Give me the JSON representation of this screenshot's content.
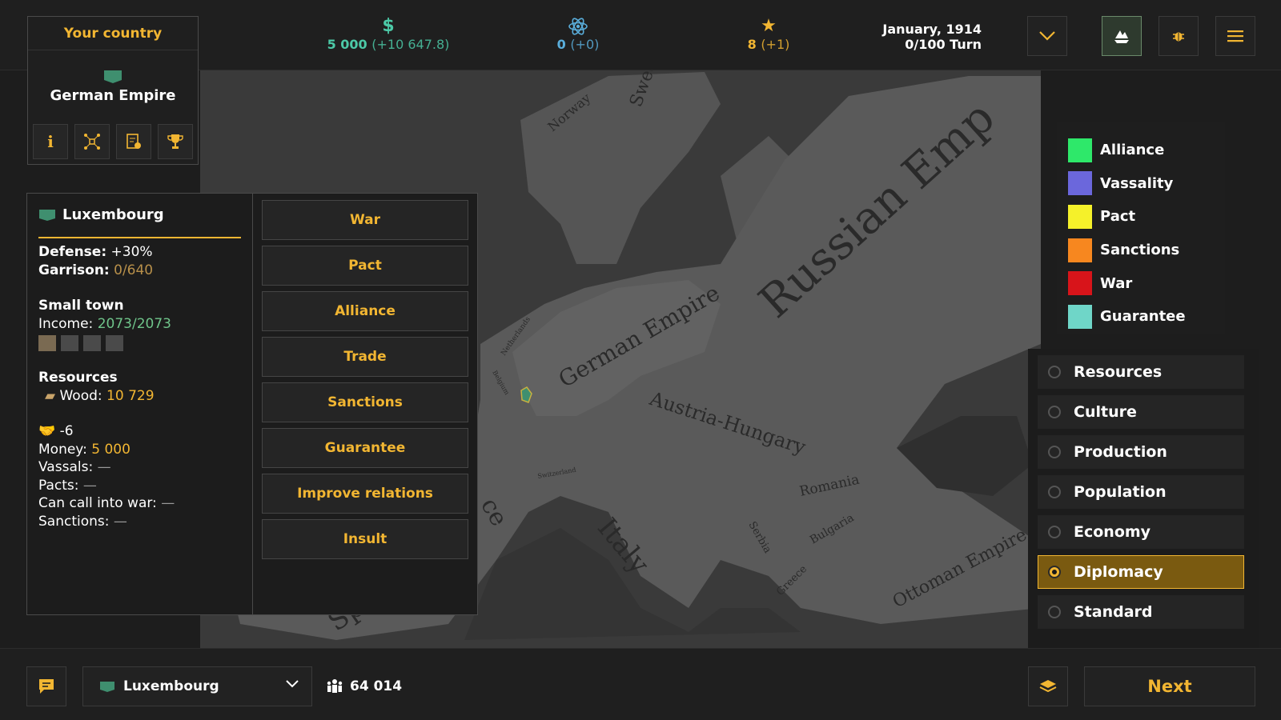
{
  "top_bar": {
    "money": {
      "value": "5 000",
      "delta": "(+10 647.8)",
      "icon": "dollar-icon"
    },
    "science": {
      "value": "0",
      "delta": "(+0)",
      "icon": "atom-icon"
    },
    "fame": {
      "value": "8",
      "delta": "(+1)",
      "icon": "star-icon"
    },
    "date": "January, 1914",
    "turn": "0/100 Turn",
    "buttons": [
      "chevron-down-icon",
      "ships-icon",
      "bug-icon",
      "menu-icon"
    ]
  },
  "your_country": {
    "title": "Your country",
    "name": "German Empire",
    "flag_color": "#3f8f6f",
    "actions": [
      "info-icon",
      "network-icon",
      "document-icon",
      "trophy-icon"
    ]
  },
  "province": {
    "name": "Luxembourg",
    "defense_label": "Defense:",
    "defense_value": "+30%",
    "garrison_label": "Garrison:",
    "garrison_value": "0/640",
    "town_type": "Small town",
    "income_label": "Income:",
    "income_value": "2073/2073",
    "resources_title": "Resources",
    "wood_label": "Wood:",
    "wood_value": "10 729",
    "relations_value": "-6",
    "money_label": "Money:",
    "money_value": "5 000",
    "vassals_label": "Vassals:",
    "vassals_value": "—",
    "pacts_label": "Pacts:",
    "pacts_value": "—",
    "callwar_label": "Can call into war:",
    "callwar_value": "—",
    "sanctions_label": "Sanctions:",
    "sanctions_value": "—"
  },
  "diplomacy_actions": [
    "War",
    "Pact",
    "Alliance",
    "Trade",
    "Sanctions",
    "Guarantee",
    "Improve relations",
    "Insult"
  ],
  "legend": [
    {
      "label": "Alliance",
      "color": "#2ee86a"
    },
    {
      "label": "Vassality",
      "color": "#6b67dc"
    },
    {
      "label": "Pact",
      "color": "#f5f12a"
    },
    {
      "label": "Sanctions",
      "color": "#f7871f"
    },
    {
      "label": "War",
      "color": "#d8141a"
    },
    {
      "label": "Guarantee",
      "color": "#6fd6c8"
    }
  ],
  "map_modes": {
    "items": [
      "Resources",
      "Culture",
      "Production",
      "Population",
      "Economy",
      "Diplomacy",
      "Standard"
    ],
    "selected": "Diplomacy"
  },
  "map_labels": {
    "norway": "Norway",
    "sweden": "Sweden",
    "russian_empire": "Russian Emp",
    "german_empire": "German Empire",
    "austria_hungary": "Austria-Hungary",
    "romania": "Romania",
    "bulgaria": "Bulgaria",
    "serbia": "Serbia",
    "greece": "Greece",
    "italy": "Italy",
    "ottoman_empire": "Ottoman Empire",
    "spain": "Spain",
    "france_fragment": "ce",
    "netherlands": "Netherlands",
    "belgium": "Belgium",
    "switzerland": "Switzerland"
  },
  "bottom_bar": {
    "province_select": "Luxembourg",
    "population": "64 014",
    "next_label": "Next"
  },
  "colors": {
    "accent": "#f2b632",
    "money": "#4cc9a7",
    "science": "#5aaedb",
    "income": "#6fc48a"
  }
}
